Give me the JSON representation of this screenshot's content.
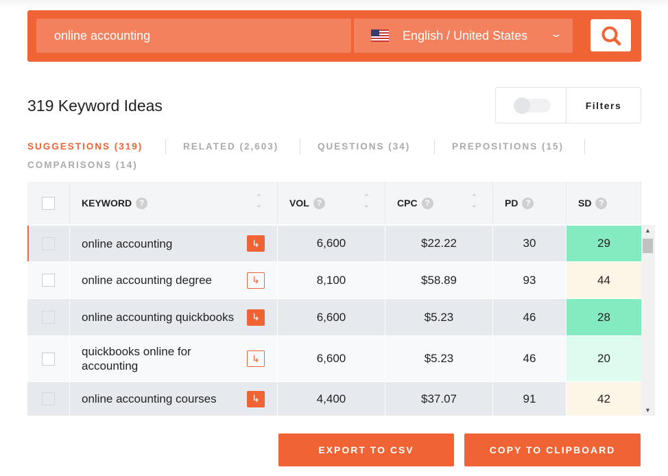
{
  "search": {
    "query": "online accounting",
    "locale": "English / United States",
    "flag_icon": "us-flag-icon",
    "search_icon": "search-icon"
  },
  "header": {
    "title": "319 Keyword Ideas",
    "filters_label": "Filters",
    "filters_toggle_on": false
  },
  "tabs": [
    {
      "label": "SUGGESTIONS (319)",
      "active": true
    },
    {
      "label": "RELATED (2,603)"
    },
    {
      "label": "QUESTIONS (34)"
    },
    {
      "label": "PREPOSITIONS (15)"
    },
    {
      "label": "COMPARISONS (14)"
    }
  ],
  "table": {
    "columns": [
      "KEYWORD",
      "VOL",
      "CPC",
      "PD",
      "SD"
    ],
    "rows": [
      {
        "keyword": "online accounting",
        "vol": "6,600",
        "cpc": "$22.22",
        "pd": "30",
        "sd": "29",
        "sd_color": "#84ebc0"
      },
      {
        "keyword": "online accounting degree",
        "vol": "8,100",
        "cpc": "$58.89",
        "pd": "93",
        "sd": "44",
        "sd_color": "#fdf6e6"
      },
      {
        "keyword": "online accounting quickbooks",
        "vol": "6,600",
        "cpc": "$5.23",
        "pd": "46",
        "sd": "28",
        "sd_color": "#84ebc0"
      },
      {
        "keyword": "quickbooks online for accounting",
        "vol": "6,600",
        "cpc": "$5.23",
        "pd": "46",
        "sd": "20",
        "sd_color": "#ddfbee"
      },
      {
        "keyword": "online accounting courses",
        "vol": "4,400",
        "cpc": "$37.07",
        "pd": "91",
        "sd": "42",
        "sd_color": "#fdf6e6"
      }
    ]
  },
  "actions": {
    "export": "EXPORT TO CSV",
    "copy": "COPY TO CLIPBOARD"
  },
  "colors": {
    "accent": "#f06334"
  }
}
